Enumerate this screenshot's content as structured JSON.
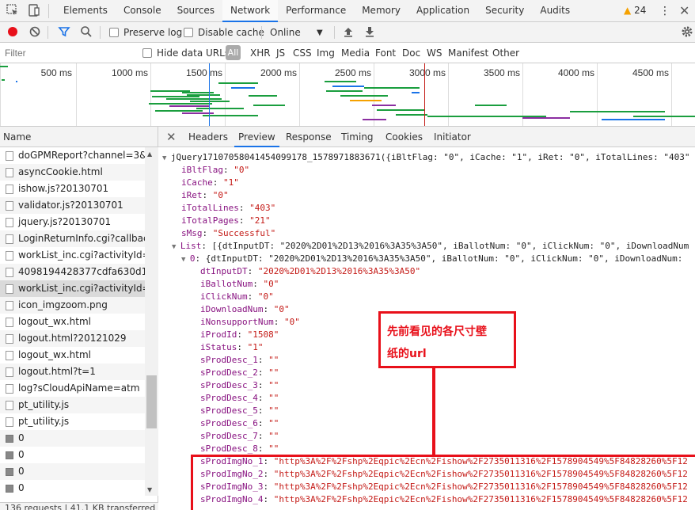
{
  "main_tabs": [
    "Elements",
    "Console",
    "Sources",
    "Network",
    "Performance",
    "Memory",
    "Application",
    "Security",
    "Audits"
  ],
  "active_main_tab": "Network",
  "warning_count": "24",
  "toolbar": {
    "preserve_log": "Preserve log",
    "disable_cache": "Disable cache",
    "throttle": "Online"
  },
  "filter": {
    "placeholder": "Filter",
    "hide_data_urls": "Hide data URLs",
    "all": "All",
    "types": [
      "XHR",
      "JS",
      "CSS",
      "Img",
      "Media",
      "Font",
      "Doc",
      "WS",
      "Manifest",
      "Other"
    ]
  },
  "timeline": {
    "ticks": [
      "500 ms",
      "1000 ms",
      "1500 ms",
      "2000 ms",
      "2500 ms",
      "3000 ms",
      "3500 ms",
      "4000 ms",
      "4500 ms",
      "5"
    ]
  },
  "list_header": "Name",
  "requests": [
    {
      "name": "doGPMReport?channel=3&sSit",
      "icon": "file"
    },
    {
      "name": "asyncCookie.html",
      "icon": "file"
    },
    {
      "name": "ishow.js?20130701",
      "icon": "file"
    },
    {
      "name": "validator.js?20130701",
      "icon": "file"
    },
    {
      "name": "jquery.js?20130701",
      "icon": "file"
    },
    {
      "name": "LoginReturnInfo.cgi?callback=",
      "icon": "file"
    },
    {
      "name": "workList_inc.cgi?activityId=273",
      "icon": "file"
    },
    {
      "name": "4098194428377cdfa630d1f857",
      "icon": "file"
    },
    {
      "name": "workList_inc.cgi?activityId=273",
      "icon": "file"
    },
    {
      "name": "icon_imgzoom.png",
      "icon": "file"
    },
    {
      "name": "logout_wx.html",
      "icon": "file"
    },
    {
      "name": "logout.html?20121029",
      "icon": "file"
    },
    {
      "name": "logout_wx.html",
      "icon": "file"
    },
    {
      "name": "logout.html?t=1",
      "icon": "file"
    },
    {
      "name": "log?sCloudApiName=atm",
      "icon": "file"
    },
    {
      "name": "pt_utility.js",
      "icon": "file"
    },
    {
      "name": "pt_utility.js",
      "icon": "file"
    },
    {
      "name": "0",
      "icon": "img"
    },
    {
      "name": "0",
      "icon": "img"
    },
    {
      "name": "0",
      "icon": "img"
    },
    {
      "name": "0",
      "icon": "img"
    }
  ],
  "selected_request_index": 8,
  "status_text": "136 requests | 41.1 KB transferred",
  "detail_tabs": [
    "Headers",
    "Preview",
    "Response",
    "Timing",
    "Cookies",
    "Initiator"
  ],
  "active_detail_tab": "Preview",
  "preview": {
    "root": "jQuery17107058041454099178_1578971883671({iBltFlag: \"0\", iCache: \"1\", iRet: \"0\", iTotalLines: \"403\"",
    "fields": [
      {
        "k": "iBltFlag",
        "v": "\"0\""
      },
      {
        "k": "iCache",
        "v": "\"1\""
      },
      {
        "k": "iRet",
        "v": "\"0\""
      },
      {
        "k": "iTotalLines",
        "v": "\"403\""
      },
      {
        "k": "iTotalPages",
        "v": "\"21\""
      },
      {
        "k": "sMsg",
        "v": "\"Successful\""
      }
    ],
    "list_line": "[{dtInputDT: \"2020%2D01%2D13%2016%3A35%3A50\", iBallotNum: \"0\", iClickNum: \"0\", iDownloadNum",
    "item_line": "{dtInputDT: \"2020%2D01%2D13%2016%3A35%3A50\", iBallotNum: \"0\", iClickNum: \"0\", iDownloadNum:",
    "item_fields": [
      {
        "k": "dtInputDT",
        "v": "\"2020%2D01%2D13%2016%3A35%3A50\""
      },
      {
        "k": "iBallotNum",
        "v": "\"0\""
      },
      {
        "k": "iClickNum",
        "v": "\"0\""
      },
      {
        "k": "iDownloadNum",
        "v": "\"0\""
      },
      {
        "k": "iNonsupportNum",
        "v": "\"0\""
      },
      {
        "k": "iProdId",
        "v": "\"1508\""
      },
      {
        "k": "iStatus",
        "v": "\"1\""
      },
      {
        "k": "sProdDesc_1",
        "v": "\"\""
      },
      {
        "k": "sProdDesc_2",
        "v": "\"\""
      },
      {
        "k": "sProdDesc_3",
        "v": "\"\""
      },
      {
        "k": "sProdDesc_4",
        "v": "\"\""
      },
      {
        "k": "sProdDesc_5",
        "v": "\"\""
      },
      {
        "k": "sProdDesc_6",
        "v": "\"\""
      },
      {
        "k": "sProdDesc_7",
        "v": "\"\""
      },
      {
        "k": "sProdDesc_8",
        "v": "\"\""
      },
      {
        "k": "sProdImgNo_1",
        "v": "\"http%3A%2F%2Fshp%2Eqpic%2Ecn%2Fishow%2F2735011316%2F1578904549%5F84828260%5F12"
      },
      {
        "k": "sProdImgNo_2",
        "v": "\"http%3A%2F%2Fshp%2Eqpic%2Ecn%2Fishow%2F2735011316%2F1578904549%5F84828260%5F12"
      },
      {
        "k": "sProdImgNo_3",
        "v": "\"http%3A%2F%2Fshp%2Eqpic%2Ecn%2Fishow%2F2735011316%2F1578904549%5F84828260%5F12"
      },
      {
        "k": "sProdImgNo_4",
        "v": "\"http%3A%2F%2Fshp%2Eqpic%2Ecn%2Fishow%2F2735011316%2F1578904549%5F84828260%5F12"
      }
    ]
  },
  "annotation": {
    "line1": "先前看见的各尺寸壁",
    "line2": "纸的url",
    "color": "#e8101a"
  }
}
